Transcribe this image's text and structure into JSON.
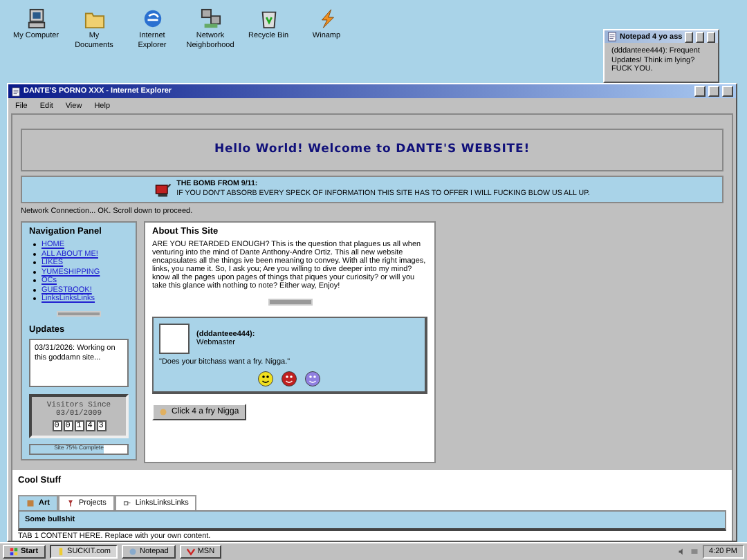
{
  "desktop_icons": [
    {
      "kind": "computer",
      "label": "My Computer"
    },
    {
      "kind": "folder",
      "label": "My Documents"
    },
    {
      "kind": "browser",
      "label": "Internet Explorer"
    },
    {
      "kind": "network",
      "label": "Network Neighborhood"
    },
    {
      "kind": "recycle",
      "label": "Recycle Bin"
    },
    {
      "kind": "player",
      "label": "Winamp"
    }
  ],
  "notepad": {
    "title": "Notepad 4 yo ass",
    "text": "(dddanteee444): Frequent Updates! Think im lying? FUCK YOU."
  },
  "browser": {
    "title": "DANTE'S PORNO XXX - Internet Explorer",
    "menu": [
      "File",
      "Edit",
      "View",
      "Help"
    ]
  },
  "page": {
    "heading": "Hello World! Welcome to DANTE'S WEBSITE!",
    "alert": {
      "title": "THE BOMB FROM 9/11:",
      "text": "IF YOU DON'T ABSORB EVERY SPECK OF INFORMATION THIS SITE HAS TO OFFER I WILL FUCKING BLOW US ALL UP."
    },
    "status_text": "Network Connection... OK. Scroll down to proceed.",
    "nav": {
      "title": "Navigation Panel",
      "links": [
        "HOME",
        "ALL ABOUT ME!",
        "LIKES",
        "YUMESHIPPING",
        "OCs",
        "GUESTBOOK!",
        "LinksLinksLinks"
      ]
    },
    "updates": {
      "title": "Updates",
      "text": "03/31/2026: Working on this goddamn site..."
    },
    "counter": {
      "title": "Visitors Since",
      "date": "03/01/2009",
      "digits": [
        "0",
        "0",
        "1",
        "4",
        "3"
      ]
    },
    "progress": {
      "label": "Site 75% Complete",
      "level": 0.75
    },
    "about": {
      "title": "About This Site",
      "text": "ARE YOU RETARDED ENOUGH? This is the question that plagues us all when venturing into the mind of Dante Anthony-Andre Ortiz. This all new website encapsulates all the things ive been meaning to convey. With all the right images, links, you name it. So, I ask you; Are you willing to dive deeper into my mind? know all the pages upon pages of things that piques your curiosity? or will you take this glance with nothing to note? Either way, Enjoy!"
    },
    "quote_card": {
      "user": "(dddanteee444):",
      "role": "Webmaster",
      "quote": "\"Does your bitchass want a fry. Nigga.\""
    },
    "fry_button": "Click 4 a fry Nigga",
    "cool_stuff": {
      "title": "Cool Stuff",
      "tabs": [
        {
          "label": "Art",
          "selected": true
        },
        {
          "label": "Projects",
          "selected": false
        },
        {
          "label": "LinksLinksLinks",
          "selected": false
        }
      ],
      "panel_title": "Some bullshit",
      "panel_text": "TAB 1 CONTENT HERE. Replace with your own content."
    }
  },
  "taskbar": {
    "start": "Start",
    "tasks": [
      {
        "label": "SUCKIT.com",
        "selected": true
      },
      {
        "label": "Notepad",
        "selected": false
      },
      {
        "label": "MSN",
        "selected": false
      }
    ],
    "clock": "4:20 PM"
  }
}
